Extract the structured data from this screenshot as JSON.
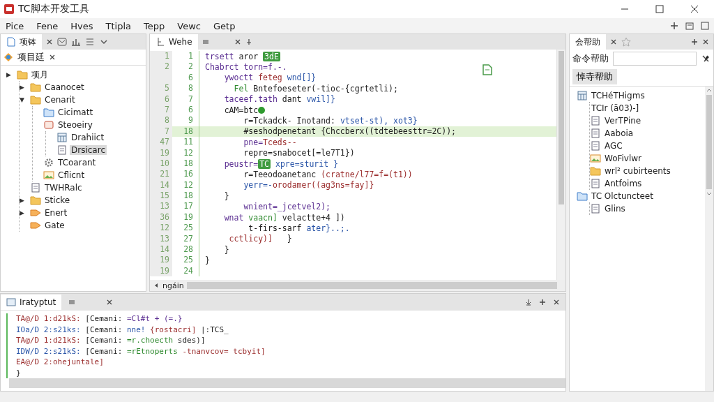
{
  "window": {
    "title": "TC脚本开发工具"
  },
  "menu": [
    "Pice",
    "Fene",
    "Hves",
    "Ttipla",
    "Tepp",
    "Vewc",
    "Getp"
  ],
  "left_panel": {
    "tabs": [
      {
        "label": "项钵",
        "selected": true
      }
    ],
    "header": "项目廷",
    "tree": [
      {
        "label": "项月",
        "toggle": "▶",
        "kind": "folder",
        "selected": false,
        "children": [
          {
            "label": "Caanocet",
            "toggle": "▶",
            "kind": "folder",
            "selected": false
          },
          {
            "label": "Cenarit",
            "toggle": "▼",
            "kind": "folder",
            "selected": false,
            "children": [
              {
                "label": "Cicimatt",
                "kind": "blue-folder",
                "selected": false
              },
              {
                "label": "Steoeiry",
                "kind": "package",
                "selected": false,
                "children": [
                  {
                    "label": "Drahiict",
                    "kind": "table",
                    "selected": false
                  },
                  {
                    "label": "Drsicarc",
                    "kind": "doc",
                    "selected": true
                  }
                ]
              },
              {
                "label": "TCoarant",
                "kind": "gear",
                "selected": false
              },
              {
                "label": "Cflicnt",
                "kind": "image",
                "selected": false
              }
            ]
          },
          {
            "label": "TWHRalc",
            "kind": "doc",
            "selected": false
          },
          {
            "label": "Sticke",
            "toggle": "▶",
            "kind": "folder",
            "selected": false
          },
          {
            "label": "Enert",
            "toggle": "▶",
            "kind": "tag",
            "selected": false
          },
          {
            "label": "Gate",
            "kind": "tag",
            "selected": false
          }
        ]
      }
    ]
  },
  "editor": {
    "tab": {
      "label": "Wehe",
      "selected": true
    },
    "footer": "ngáin",
    "lines": [
      {
        "n1": "1",
        "n2": "1",
        "current": false,
        "segs": [
          {
            "kind": "kw",
            "text": "trsett"
          },
          {
            "kind": "plain",
            "text": " aror "
          },
          {
            "kind": "tag",
            "text": "3dE"
          }
        ]
      },
      {
        "n1": "2",
        "n2": "2",
        "current": false,
        "segs": [
          {
            "kind": "kw",
            "text": "Chabrct torn=f.-."
          }
        ]
      },
      {
        "n2": "6",
        "current": false,
        "segs": [
          {
            "kind": "kw",
            "text": "    ywoctt "
          },
          {
            "kind": "str",
            "text": "feteg "
          },
          {
            "kind": "var",
            "text": "wnd[]}"
          }
        ]
      },
      {
        "n1": "5",
        "n2": "8",
        "current": false,
        "segs": [
          {
            "kind": "cm",
            "text": "      Fel "
          },
          {
            "kind": "plain",
            "text": "Bntefoeseter(-tioc-{cgrtetli);"
          }
        ]
      },
      {
        "n1": "6",
        "n2": "7",
        "current": false,
        "segs": [
          {
            "kind": "kw",
            "text": "    taceef.tath "
          },
          {
            "kind": "plain",
            "text": "dant "
          },
          {
            "kind": "var",
            "text": "vwil]}"
          }
        ]
      },
      {
        "n1": "7",
        "n2": "6",
        "current": false,
        "segs": [
          {
            "kind": "plain",
            "text": "    cAM=btc"
          },
          {
            "kind": "dot"
          }
        ]
      },
      {
        "n1": "8",
        "n2": "9",
        "current": false,
        "segs": [
          {
            "kind": "plain",
            "text": "        r=Tckadck- Inotand: "
          },
          {
            "kind": "var",
            "text": "vtset-st), xot3}"
          }
        ]
      },
      {
        "n1": "7",
        "n2": "18",
        "current": true,
        "segs": [
          {
            "kind": "plain",
            "text": "        #seshodpenetant {Chccberx((tdtebeesttr=2C));"
          }
        ]
      },
      {
        "n1": "47",
        "n2": "11",
        "current": false,
        "segs": [
          {
            "kind": "kw",
            "text": "        pne="
          },
          {
            "kind": "str",
            "text": "Tceds--"
          }
        ]
      },
      {
        "n1": "19",
        "n2": "12",
        "current": false,
        "segs": [
          {
            "kind": "plain",
            "text": "        repre=snabocet[=le7T1})"
          }
        ]
      },
      {
        "n1": "10",
        "n2": "18",
        "current": false,
        "segs": [
          {
            "kind": "kw",
            "text": "    peustr="
          },
          {
            "kind": "tag",
            "text": "TC"
          },
          {
            "kind": "var",
            "text": " xpre=sturit }"
          }
        ]
      },
      {
        "n1": "21",
        "n2": "16",
        "current": false,
        "segs": [
          {
            "kind": "plain",
            "text": "        r=Teeodoanetanc "
          },
          {
            "kind": "str",
            "text": "(cratne/l77=f=(t1))"
          }
        ]
      },
      {
        "n1": "14",
        "n2": "12",
        "current": false,
        "segs": [
          {
            "kind": "var",
            "text": "        yerr=-"
          },
          {
            "kind": "str",
            "text": "orodamer((ag3ns=fay]}"
          }
        ]
      },
      {
        "n1": "15",
        "n2": "18",
        "current": false,
        "segs": [
          {
            "kind": "plain",
            "text": "    }"
          }
        ]
      },
      {
        "n1": "13",
        "n2": "17",
        "current": false,
        "segs": [
          {
            "kind": "kw",
            "text": "        wnient=_jcetvel2);"
          }
        ]
      },
      {
        "n1": "36",
        "n2": "19",
        "current": false,
        "segs": [
          {
            "kind": "kw",
            "text": "    wnat "
          },
          {
            "kind": "cm",
            "text": "vaacn] "
          },
          {
            "kind": "plain",
            "text": "velactte+4 ])"
          }
        ]
      },
      {
        "n1": "12",
        "n2": "25",
        "current": false,
        "segs": [
          {
            "kind": "plain",
            "text": "         t-firs-sarf "
          },
          {
            "kind": "var",
            "text": "ater}..;."
          }
        ]
      },
      {
        "n1": "13",
        "n2": "27",
        "current": false,
        "segs": [
          {
            "kind": "str",
            "text": "     cctlicy)]"
          },
          {
            "kind": "plain",
            "text": "   }"
          }
        ]
      },
      {
        "n1": "14",
        "n2": "28",
        "current": false,
        "segs": [
          {
            "kind": "plain",
            "text": "    }"
          }
        ]
      },
      {
        "n1": "19",
        "n2": "25",
        "current": false,
        "segs": [
          {
            "kind": "plain",
            "text": "}"
          }
        ]
      },
      {
        "n1": "19",
        "n2": "24",
        "current": false
      }
    ]
  },
  "output": {
    "tab": {
      "label": "Iratyptut",
      "selected": true
    },
    "lines": [
      {
        "segs": [
          {
            "kind": "str",
            "text": "TA@/D 1:d21kS: "
          },
          {
            "kind": "plain",
            "text": "[Cemani: "
          },
          {
            "kind": "kw",
            "text": "=Cl#t + (=.}"
          }
        ]
      },
      {
        "segs": [
          {
            "kind": "var",
            "text": "IOa/D 2:s21ks: "
          },
          {
            "kind": "plain",
            "text": "[Cemani: "
          },
          {
            "kind": "var",
            "text": "nne! "
          },
          {
            "kind": "str",
            "text": "{rostacri] "
          },
          {
            "kind": "plain",
            "text": "|:TCS_"
          }
        ]
      },
      {
        "segs": [
          {
            "kind": "str",
            "text": "TA@/D 1:d21kS: "
          },
          {
            "kind": "plain",
            "text": "[Cemani: "
          },
          {
            "kind": "cm",
            "text": "=r.choecth "
          },
          {
            "kind": "plain",
            "text": "sdes)]"
          }
        ]
      },
      {
        "segs": [
          {
            "kind": "var",
            "text": "IDW/D 2:s21kS: "
          },
          {
            "kind": "plain",
            "text": "[Cemani: "
          },
          {
            "kind": "cm",
            "text": "=rEtnoperts "
          },
          {
            "kind": "str",
            "text": "-tnanvcov= tcbyit]"
          }
        ]
      },
      {
        "segs": [
          {
            "kind": "str",
            "text": "EA@/D 2:ohejuntale]"
          }
        ]
      },
      {
        "segs": [
          {
            "kind": "plain",
            "text": "}"
          }
        ]
      }
    ]
  },
  "right_panel": {
    "tab": {
      "label": "会帮助",
      "selected": true
    },
    "label": "命令帮助",
    "button": "悼寺帮助",
    "tree": [
      {
        "label": "TCHéTHigms",
        "kind": "table",
        "children": [
          {
            "label": "TCIr (ä03)-]",
            "kind": "none"
          },
          {
            "label": "VerTPine",
            "kind": "doc"
          },
          {
            "label": "Aaboia",
            "kind": "doc"
          },
          {
            "label": "AGC",
            "kind": "doc"
          },
          {
            "label": "WoFivlwr",
            "kind": "image"
          },
          {
            "label": "wrl² cubirteents",
            "kind": "folder"
          },
          {
            "label": "Antfoims",
            "kind": "doc"
          }
        ]
      },
      {
        "label": "TC Olctuncteet",
        "kind": "blue-folder",
        "children": [
          {
            "label": "Glins",
            "kind": "doc"
          }
        ]
      }
    ]
  }
}
